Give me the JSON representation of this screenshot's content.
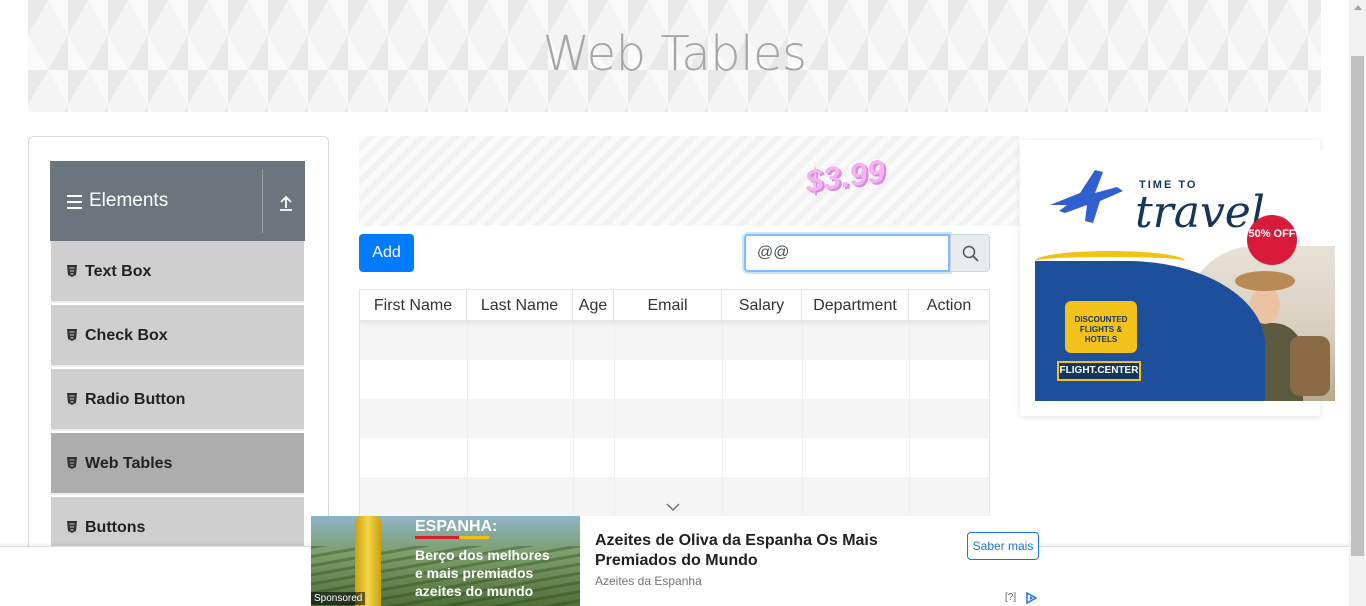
{
  "page": {
    "title": "Web Tables"
  },
  "sidebar": {
    "group_title": "Elements",
    "items": [
      {
        "label": "Text Box"
      },
      {
        "label": "Check Box"
      },
      {
        "label": "Radio Button"
      },
      {
        "label": "Web Tables",
        "active": true
      },
      {
        "label": "Buttons"
      }
    ]
  },
  "promo_ad": {
    "price": "$3.99"
  },
  "toolbar": {
    "add_label": "Add"
  },
  "search": {
    "value": "@@",
    "placeholder": "Type to search"
  },
  "table": {
    "columns": [
      "First Name",
      "Last Name",
      "Age",
      "Email",
      "Salary",
      "Department",
      "Action"
    ],
    "rows": []
  },
  "side_ad": {
    "close": "✕",
    "top_text": "TIME TO",
    "script_text": "travel",
    "badge": "50% OFF",
    "bubble": "DISCOUNTED FLIGHTS & HOTELS",
    "brand": "FLIGHT.CENTER"
  },
  "bottom_ad": {
    "image_heading": "ESPANHA:",
    "image_text": "Berço dos melhores\ne mais premiados\nazeites do mundo",
    "sponsored": "Sponsored",
    "headline": "Azeites de Oliva da Espanha Os Mais Premiados do Mundo",
    "advertiser": "Azeites da Espanha",
    "cta": "Saber mais",
    "info": "[?]"
  },
  "colors": {
    "primary": "#007bff",
    "header_gray": "#6c757d",
    "menu_gray": "#cfcfcf",
    "menu_active": "#adadad"
  }
}
